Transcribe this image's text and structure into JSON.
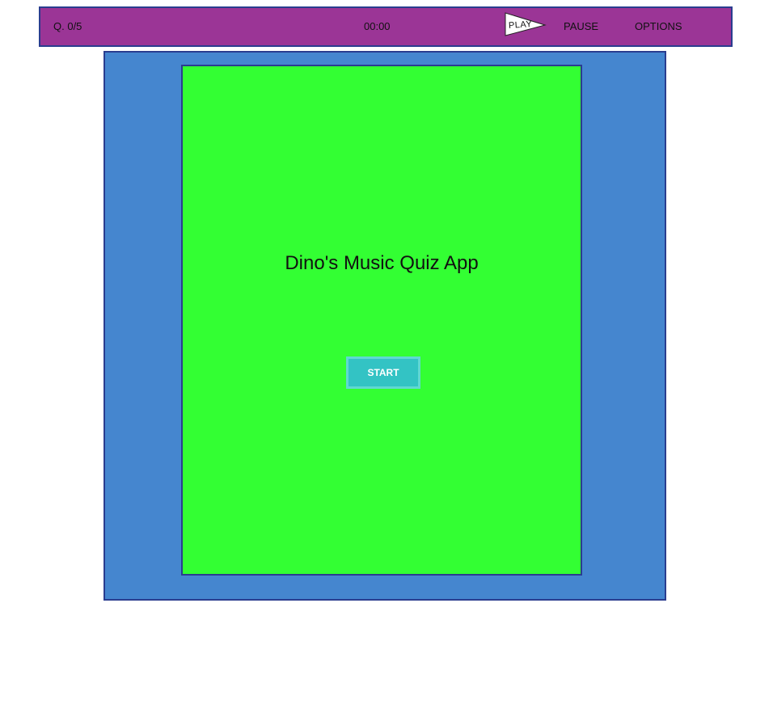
{
  "topbar": {
    "question_counter": "Q. 0/5",
    "timer": "00:00",
    "play_label": "PLAY",
    "pause_label": "PAUSE",
    "options_label": "OPTIONS",
    "play_icon": "flag-icon"
  },
  "main": {
    "title": "Dino's Music Quiz App",
    "start_label": "START"
  },
  "colors": {
    "topbar_bg": "#9b3596",
    "stage_bg": "#4586cf",
    "panel_bg": "#33ff33",
    "start_button_bg": "#33c3c4",
    "border": "#2a3d8f"
  }
}
